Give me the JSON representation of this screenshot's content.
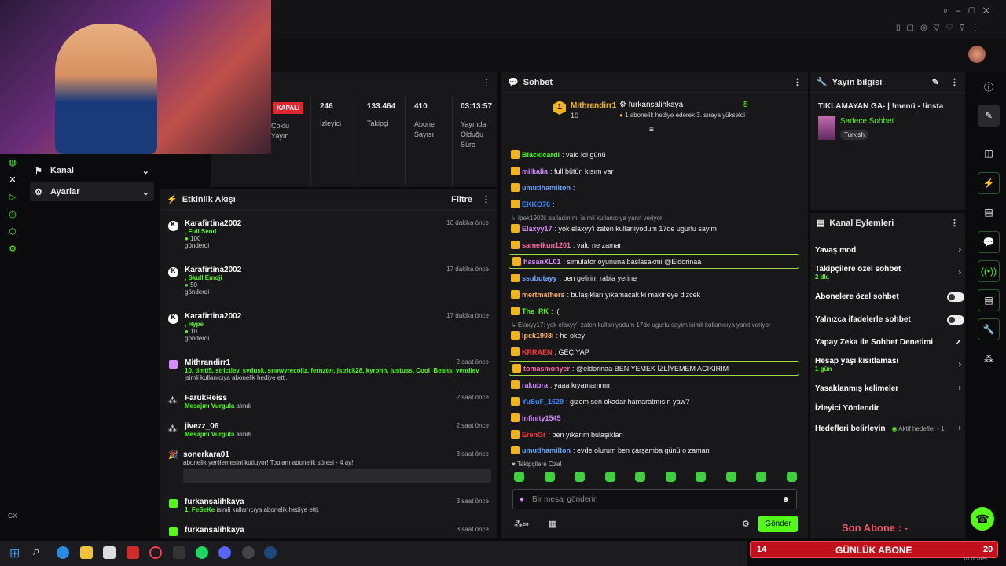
{
  "sidebar": {
    "items": [
      {
        "label": "Kanal"
      },
      {
        "label": "Ayarlar"
      }
    ],
    "bottom": "GX"
  },
  "stats": {
    "status": "KAPALI",
    "status_caption": "Çoklu Yayın",
    "items": [
      {
        "value": "246",
        "label": "İzleyici"
      },
      {
        "value": "133.464",
        "label": "Takipçi"
      },
      {
        "value": "410",
        "label": "Abone Sayısı"
      },
      {
        "value": "03:13:57",
        "label": "Yayında Olduğu Süre"
      }
    ]
  },
  "activity": {
    "title": "Etkinlik Akışı",
    "filter": "Filtre",
    "events": [
      {
        "name": "Karafirtina2002",
        "l2": ", Full Send",
        "amount": "100",
        "l3": "gönderdi",
        "time": "16 dakika önce"
      },
      {
        "name": "Karafirtina2002",
        "l2": ", Skull Emoji",
        "amount": "50",
        "l3": "gönderdi",
        "time": "17 dakika önce"
      },
      {
        "name": "Karafirtina2002",
        "l2": ", Hype",
        "amount": "10",
        "l3": "gönderdi",
        "time": "17 dakika önce"
      },
      {
        "name": "Mithrandirr1",
        "l2": "10, timti5, strictley, svdusk, snowyrecoilz, fernzter, jstrick28, kyrohh, justuss, Cool_Beans, vendiev",
        "l3": "isimli kullanıcıya abonelik hediye etti.",
        "time": "2 saat önce"
      },
      {
        "name": "FarukReiss",
        "l2": "Mesajını Vurgula",
        "l3": "alındı",
        "time": "2 saat önce"
      },
      {
        "name": "jivezz_06",
        "l2": "Mesajını Vurgula",
        "l3": "alındı",
        "time": "2 saat önce"
      },
      {
        "name": "sonerkara01",
        "l3": "abonelik yenilemesini kutluyor! Toplam abonelik süresi - 4 ay!",
        "time": "3 saat önce"
      },
      {
        "name": "furkansalihkaya",
        "l2": "1, FeSeKe",
        "l3": "isimli kullanıcıya abonelik hediye etti.",
        "time": "3 saat önce"
      },
      {
        "name": "furkansalihkaya",
        "time": "3 saat önce"
      }
    ]
  },
  "chat": {
    "title": "Sohbet",
    "pinned": {
      "rank": "1",
      "user": "Mithrandirr1",
      "count": "10",
      "user2": "furkansalihkaya",
      "count2": "5",
      "text": "1 abonelik hediye ederek 3. sıraya yükseldi"
    },
    "messages": [
      {
        "user": "Blacklcardi",
        "color": "#53fc18",
        "text": ": valo lol günü"
      },
      {
        "user": "milkalia",
        "color": "#d88cff",
        "text": ": full bütün kısım var"
      },
      {
        "user": "umutlhamilton",
        "color": "#6aa8ff",
        "text": ":"
      },
      {
        "user": "EKKO76",
        "color": "#3a8bff",
        "text": ":"
      },
      {
        "reply": "Ipek1903i: salladın mı isimli kullanıcıya yanıt veriyor"
      },
      {
        "user": "Elaxyy17",
        "color": "#d88cff",
        "text": ": yok elaxyy'i zaten kullaniyodum 17de ugurlu sayim"
      },
      {
        "user": "sametkun1201",
        "color": "#ff6aa8",
        "text": ": valo ne zaman"
      },
      {
        "user": "hasanXL01",
        "color": "#d88cff",
        "text": ": simulator oyununa baslasakmi @Eldorinaa",
        "hl": true
      },
      {
        "user": "ssubutayy",
        "color": "#6aa8ff",
        "text": ": ben gelirim rabia yerine"
      },
      {
        "user": "mertmathers",
        "color": "#ffb26a",
        "text": ": bulaşıkları yıkamacak ki makineye dizcek"
      },
      {
        "user": "The_RK",
        "color": "#53fc18",
        "text": ": :("
      },
      {
        "reply": "Elaxyy17: yok elaxyy'i zaten kullaniyodum 17de ugurlu sayim isimli kullanıcıya yanıt veriyor"
      },
      {
        "user": "Ipek1903i",
        "color": "#ffb26a",
        "text": ": he okey"
      },
      {
        "user": "KRRAEN",
        "color": "#ff3a3a",
        "text": ": GEÇ YAP"
      },
      {
        "user": "tomasmonyer",
        "color": "#ff6aa8",
        "text": ": @eldorinaa BEN YEMEK İZLİYEMEM ACIKIRIM",
        "hl": true
      },
      {
        "user": "rakubra",
        "color": "#d88cff",
        "text": ": yaaa kıyamammm"
      },
      {
        "user": "YuSuF_1629",
        "color": "#3a8bff",
        "text": ": gizem sen okadar hamaratmısın yaw?"
      },
      {
        "user": "Infinity1545",
        "color": "#d88cff",
        "text": ":"
      },
      {
        "user": "ErenGr",
        "color": "#ff3a3a",
        "text": ": ben yıkarım bulaşıkları"
      },
      {
        "user": "umutlhamilton",
        "color": "#6aa8ff",
        "text": ": evde olurum ben çarşamba günü o zaman"
      }
    ],
    "emote_label": "Takipçilere Özel",
    "input_placeholder": "Bir mesaj gönderin",
    "send": "Gönder"
  },
  "stream_info": {
    "title": "Yayın bilgisi",
    "stream_title": "TIKLAMAYAN GA- | !menü - !insta",
    "category": "Sadece Sohbet",
    "tag": "Turkish"
  },
  "actions": {
    "title": "Kanal Eylemleri",
    "items": [
      {
        "label": "Yavaş mod"
      },
      {
        "label": "Takipçilere özel sohbet",
        "sub": "2 dk."
      },
      {
        "label": "Abonelere özel sohbet"
      },
      {
        "label": "Yalnızca ifadelerle sohbet"
      },
      {
        "label": "Yapay Zeka ile Sohbet Denetimi"
      },
      {
        "label": "Hesap yaşı kısıtlaması",
        "sub": "1 gün"
      },
      {
        "label": "Yasaklanmış kelimeler"
      },
      {
        "label": "İzleyici Yönlendir"
      },
      {
        "label": "Hedefleri belirleyin",
        "sub": "Aktif hedefler - 1"
      }
    ]
  },
  "overlay": {
    "son_abone": "Son Abone : -",
    "goal_count": "14",
    "goal_label": "GÜNLÜK ABONE",
    "goal_total": "20"
  },
  "taskbar": {
    "date": "10.11.2025"
  }
}
